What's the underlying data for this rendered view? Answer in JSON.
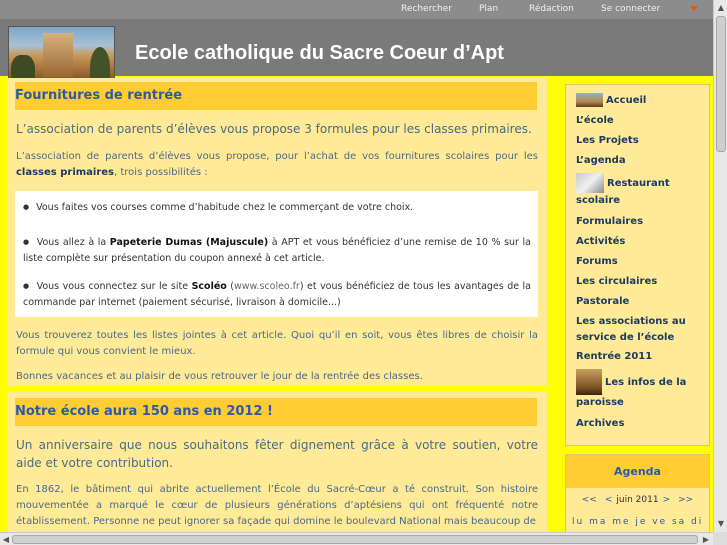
{
  "topbar": {
    "links": [
      "Rechercher",
      "Plan",
      "Rédaction",
      "Se connecter"
    ]
  },
  "header": {
    "title": "Ecole catholique du Sacre Coeur d’Apt"
  },
  "article1": {
    "title": "Fournitures de rentrée",
    "lead": "L’association de parents d’élèves vous propose 3 formules pour les classes primaires.",
    "intro_before": "L’association de parents d’élèves vous propose, pour l’achat de vos fournitures scolaires pour les ",
    "intro_bold": "classes primaires",
    "intro_after": ", trois possibilités :",
    "item1": "Vous faites vos courses comme d’habitude chez le commerçant de votre choix.",
    "item2_before": "Vous allez à la ",
    "item2_bold": "Papeterie Dumas (Majuscule)",
    "item2_after": " à APT et vous bénéficiez d’une remise de 10 % sur la liste complète sur présentation du coupon annexé à cet article.",
    "item3_before": "Vous vous connectez sur le site ",
    "item3_bold": "Scoléo",
    "item3_url": "www.scoleo.fr",
    "item3_after": ") et vous bénéficiez de tous les avantages de la commande par internet (paiement sécurisé, livraison à domicile...)",
    "para2": "Vous trouverez toutes les listes jointes à cet article. Quoi qu’il en soit, vous êtes libres de choisir la formule qui vous convient le mieux.",
    "para3": "Bonnes vacances et au plaisir de vous retrouver le jour de la rentrée des classes."
  },
  "article2": {
    "title": "Notre école aura 150 ans en 2012 !",
    "lead": "Un anniversaire que nous souhaitons fêter dignement grâce à votre soutien, votre aide et votre contribution.",
    "para1": "En 1862, le bâtiment qui abrite actuellement l’École du Sacré-Cœur a té construit. Son histoire mouvementée a marqué le cœur de plusieurs générations d’aptésiens qui ont fréquenté notre établissement. Personne ne peut ignorer sa façade qui domine le boulevard National mais beaucoup de"
  },
  "sidebar": {
    "items": [
      "Accueil",
      "L’école",
      "Les Projets",
      "L’agenda",
      "Restaurant scolaire",
      "Formulaires",
      "Activités",
      "Forums",
      "Les circulaires",
      "Pastorale",
      "Les associations au service de l’école",
      "Rentrée 2011",
      "Les infos de la paroisse",
      "Archives"
    ]
  },
  "agenda": {
    "title": "Agenda",
    "prev_year": "<<",
    "prev_month": "<",
    "month": "juin 2011",
    "next_month": ">",
    "next_year": ">>",
    "days": "lu ma me je ve sa di"
  },
  "colors": {
    "page_bg": "#ffff00",
    "content_bg": "#ffea97",
    "heading_bar": "#ffcc33",
    "heading_text": "#2a5aa8",
    "header_bg": "#7a7a7a",
    "topbar_bg": "#8c8c8c"
  }
}
